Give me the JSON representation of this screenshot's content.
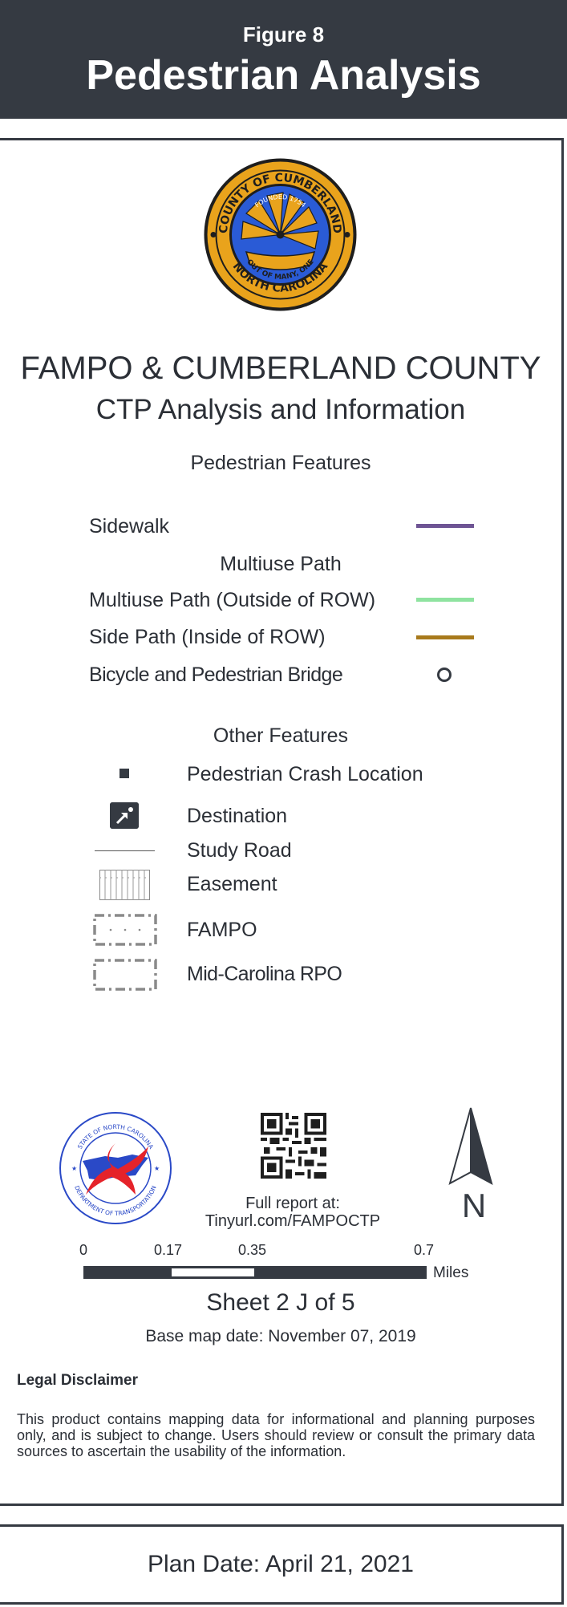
{
  "header": {
    "figure_number": "Figure 8",
    "figure_title": "Pedestrian Analysis",
    "background_color": "#353a42"
  },
  "seal": {
    "icon": "county-seal-icon",
    "text_top": "COUNTY OF CUMBERLAND",
    "founded": "FOUNDED 1754",
    "motto": "OUT OF MANY, ONE",
    "text_bottom": "NORTH CAROLINA"
  },
  "titles": {
    "primary": "FAMPO & CUMBERLAND COUNTY",
    "secondary": "CTP Analysis and Information"
  },
  "pedestrian_features": {
    "heading": "Pedestrian Features",
    "sidewalk": {
      "label": "Sidewalk",
      "color": "#6e5494"
    },
    "multiuse_heading": "Multiuse Path",
    "multiuse_outside": {
      "label": "Multiuse Path (Outside of ROW)",
      "color": "#8fe3a0"
    },
    "side_path": {
      "label": "Side Path (Inside of ROW)",
      "color": "#a87a1c"
    },
    "bridge": {
      "label": "Bicycle and Pedestrian Bridge",
      "icon": "ring-icon"
    }
  },
  "other_features": {
    "heading": "Other Features",
    "crash": {
      "label": "Pedestrian Crash Location",
      "icon": "square-icon"
    },
    "destination": {
      "label": "Destination",
      "icon": "pedestrian-destination-icon"
    },
    "study_road": {
      "label": "Study Road"
    },
    "easement": {
      "label": "Easement",
      "icon": "easement-grid-icon"
    },
    "fampo": {
      "label": "FAMPO",
      "icon": "dotted-boundary-icon"
    },
    "mid_carolina": {
      "label": "Mid-Carolina RPO",
      "icon": "dashed-boundary-icon"
    }
  },
  "footer": {
    "ncdot": {
      "icon": "ncdot-logo-icon",
      "text_top": "STATE OF NORTH CAROLINA",
      "text_bottom": "DEPARTMENT OF TRANSPORTATION"
    },
    "qr_icon": "qr-code-icon",
    "north_arrow": {
      "icon": "north-arrow-icon",
      "letter": "N"
    },
    "report_line1": "Full report at:",
    "report_line2": "Tinyurl.com/FAMPOCTP",
    "scale": {
      "ticks": [
        "0",
        "0.17",
        "0.35",
        "0.7"
      ],
      "unit": "Miles"
    },
    "sheet": "Sheet 2 J of 5",
    "base_map_date": "Base map date: November 07, 2019",
    "legal_heading": "Legal Disclaimer",
    "legal_text": "This product contains mapping data for informational and planning purposes only, and is subject to change. Users should review or consult the primary data sources to ascertain the usability of the information."
  },
  "plan_date": "Plan Date: April 21, 2021"
}
